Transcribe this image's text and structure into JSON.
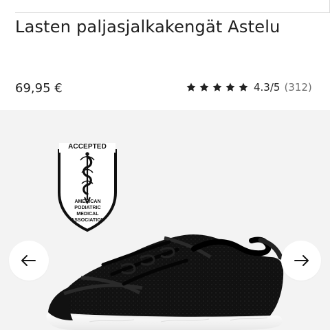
{
  "product": {
    "title": "Lasten paljasjalkakengät Astelu",
    "price": "69,95 €",
    "rating": {
      "stars": 5,
      "score": "4.3/5",
      "count": "(312)"
    }
  },
  "gallery": {
    "badge": {
      "top_text": "ACCEPTED",
      "caption_lines": [
        "AMERICAN",
        "PODIATRIC",
        "MEDICAL",
        "ASSOCIATION"
      ]
    },
    "navigation": {
      "previous_icon": "arrow-left-icon",
      "next_icon": "arrow-right-icon"
    },
    "colors": {
      "background": "#f3f3f3",
      "shoe_upper": "#111111",
      "sole": "#ffffff"
    }
  }
}
